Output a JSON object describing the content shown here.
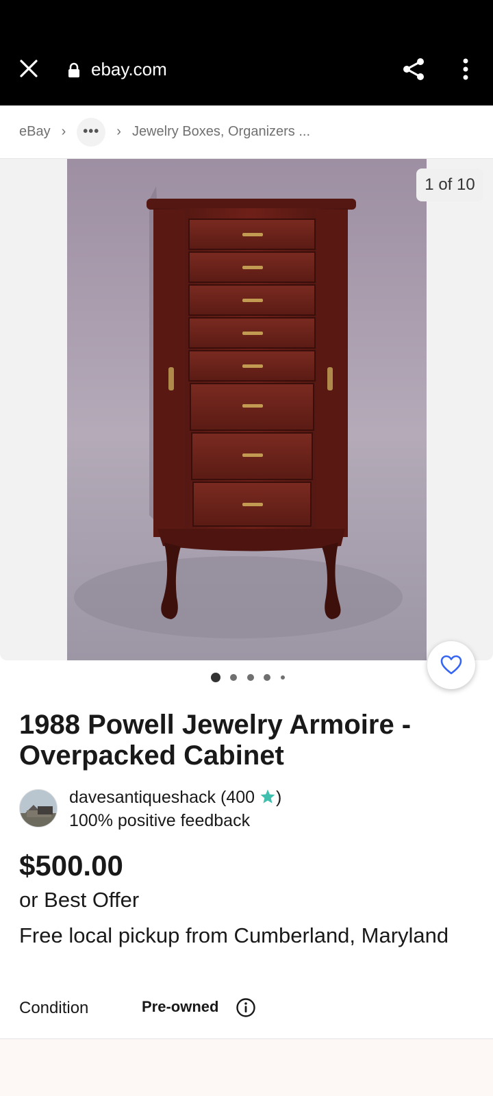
{
  "browser": {
    "domain": "ebay.com",
    "icons": {
      "close": "close-icon",
      "lock": "lock-icon",
      "share": "share-icon",
      "menu": "more-vertical-icon"
    }
  },
  "breadcrumb": {
    "items": [
      "eBay",
      "Jewelry Boxes, Organizers ..."
    ],
    "collapsed_icon": "ellipsis-icon"
  },
  "gallery": {
    "counter": "1 of 10",
    "current_index": 1,
    "total": 10,
    "image": "jewelry-armoire-photo",
    "watch_icon": "heart-icon"
  },
  "listing": {
    "title": "1988 Powell Jewelry Armoire - Overpacked Cabinet",
    "seller": {
      "name": "davesantiqueshack",
      "rating_open": "(400",
      "rating_close": ")",
      "star_color": "#3fbfad",
      "feedback": "100% positive feedback"
    },
    "price": "$500.00",
    "best_offer": "or Best Offer",
    "pickup": "Free local pickup from Cumberland, Maryland",
    "condition_label": "Condition",
    "condition_value": "Pre-owned"
  },
  "colors": {
    "accent_blue": "#3665f3",
    "text": "#191919",
    "muted": "#707070"
  }
}
